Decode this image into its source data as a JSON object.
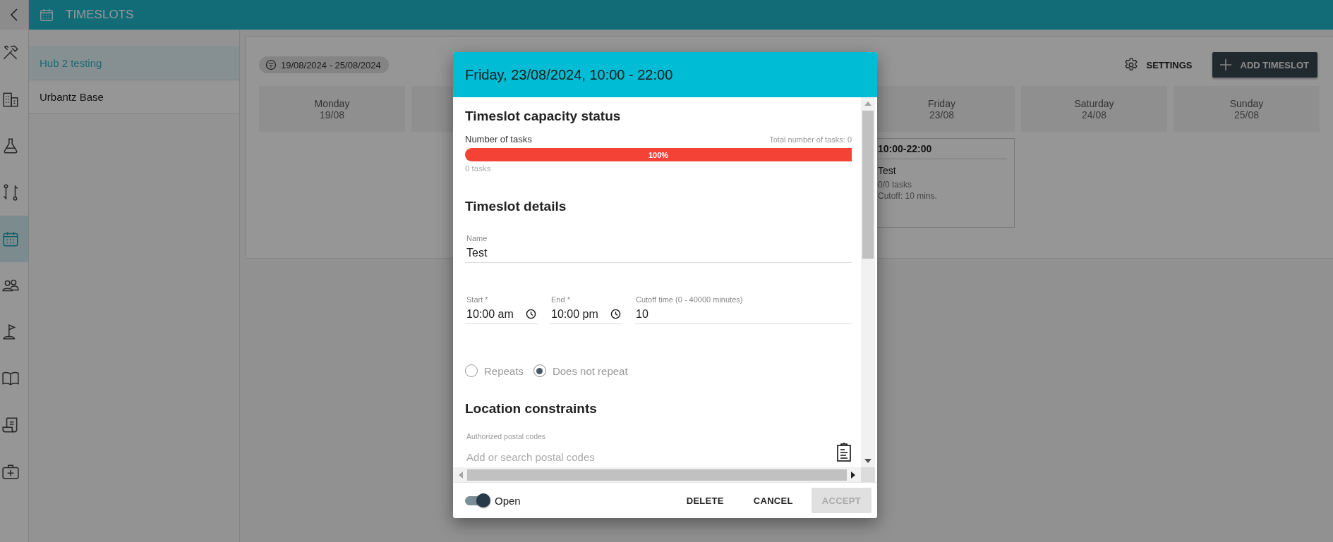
{
  "app_bar": {
    "title": "TIMESLOTS"
  },
  "rail": [
    {
      "kind": "tools",
      "selected": false
    },
    {
      "kind": "building",
      "selected": false
    },
    {
      "kind": "flask",
      "selected": false
    },
    {
      "kind": "swap",
      "selected": false
    },
    {
      "kind": "calendar",
      "selected": true
    },
    {
      "kind": "people",
      "selected": false
    },
    {
      "kind": "flag",
      "selected": false
    },
    {
      "kind": "book",
      "selected": false
    },
    {
      "kind": "receipt",
      "selected": false
    },
    {
      "kind": "medkit",
      "selected": false
    }
  ],
  "hubs": [
    {
      "name": "Hub 2 testing",
      "selected": true
    },
    {
      "name": "Urbantz Base",
      "selected": false
    }
  ],
  "toolbar": {
    "date_range": "19/08/2024 - 25/08/2024",
    "settings": "SETTINGS",
    "add": "ADD TIMESLOT"
  },
  "days": [
    {
      "name": "Monday",
      "date": "19/08"
    },
    {
      "name": "Friday",
      "date": "23/08",
      "slots": [
        {
          "time": "10:00-22:00",
          "name": "Test",
          "tasks": "0/0 tasks",
          "cutoff": "Cutoff: 10 mins."
        }
      ]
    },
    {
      "name": "Saturday",
      "date": "24/08"
    },
    {
      "name": "Sunday",
      "date": "25/08"
    }
  ],
  "dialog": {
    "title": "Friday, 23/08/2024, 10:00 - 22:00",
    "capacity": {
      "heading": "Timeslot capacity status",
      "label": "Number of tasks",
      "total": "Total number of tasks: 0",
      "level": 1,
      "bar_text": "100%",
      "count": "0 tasks"
    },
    "details": {
      "heading": "Timeslot details",
      "name": {
        "label": "Name",
        "value": "Test"
      },
      "start": {
        "label": "Start *",
        "value": "10:00 am"
      },
      "end": {
        "label": "End *",
        "value": "10:00 pm"
      },
      "cutoff": {
        "label": "Cutoff time (0 - 40000 minutes)",
        "value": "10"
      },
      "repeat_options": [
        {
          "label": "Repeats",
          "selected": false
        },
        {
          "label": "Does not repeat",
          "selected": true
        }
      ]
    },
    "location": {
      "heading": "Location constraints",
      "postal_codes": {
        "label": "Authorized postal codes",
        "placeholder": "Add or search postal codes"
      }
    },
    "open": {
      "label": "Open",
      "on": true
    },
    "buttons": [
      {
        "label": "DELETE",
        "disabled": false
      },
      {
        "label": "CANCEL",
        "disabled": false
      },
      {
        "label": "ACCEPT",
        "disabled": true
      }
    ]
  }
}
